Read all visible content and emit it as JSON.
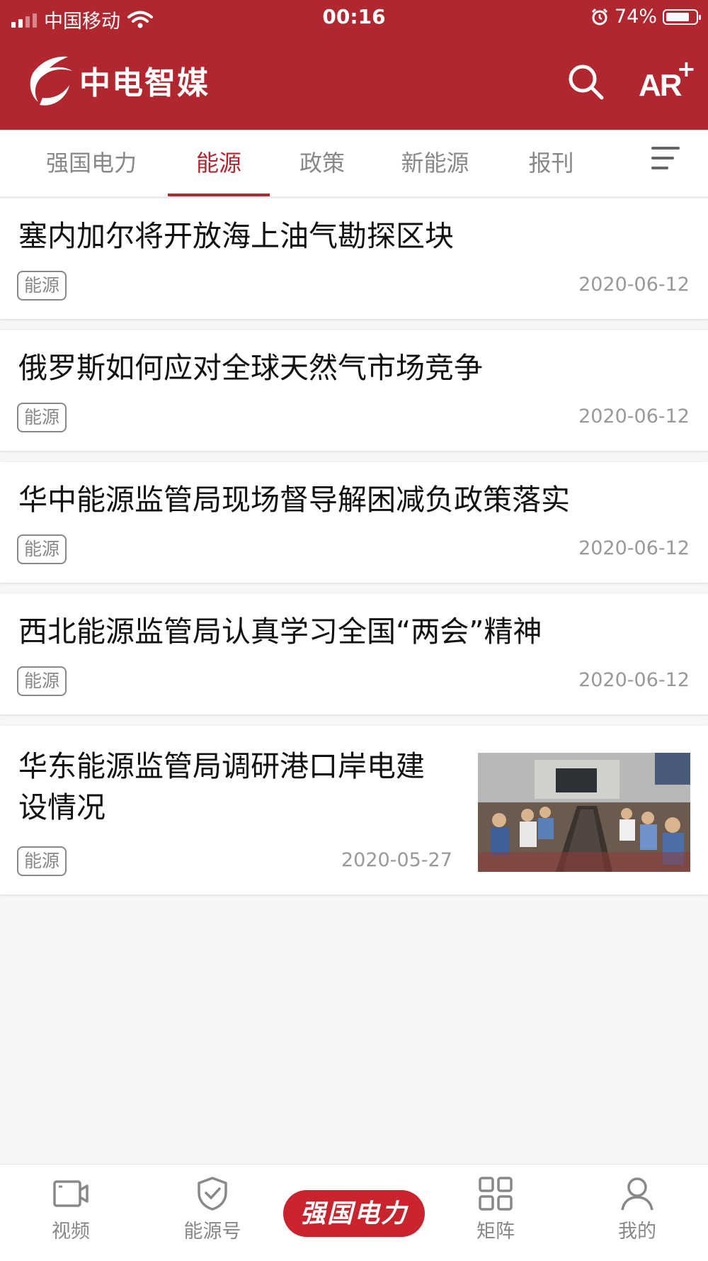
{
  "status_bar": {
    "carrier": "中国移动",
    "time": "00:16",
    "battery": "74%",
    "battery_level": 0.74
  },
  "header": {
    "app_name": "中电智媒",
    "ar_label": "AR",
    "ar_plus": "+",
    "brand_color": "#b0272f"
  },
  "tabs": [
    {
      "label": "强国电力",
      "active": false
    },
    {
      "label": "能源",
      "active": true
    },
    {
      "label": "政策",
      "active": false
    },
    {
      "label": "新能源",
      "active": false
    },
    {
      "label": "报刊",
      "active": false
    }
  ],
  "articles": [
    {
      "title": "塞内加尔将开放海上油气勘探区块",
      "tag": "能源",
      "date": "2020-06-12"
    },
    {
      "title": "俄罗斯如何应对全球天然气市场竞争",
      "tag": "能源",
      "date": "2020-06-12"
    },
    {
      "title": "华中能源监管局现场督导解困减负政策落实",
      "tag": "能源",
      "date": "2020-06-12"
    },
    {
      "title": "西北能源监管局认真学习全国“两会”精神",
      "tag": "能源",
      "date": "2020-06-12"
    },
    {
      "title_line1": "华东能源监管局调研港口岸电建",
      "title_line2": "设情况",
      "tag": "能源",
      "date": "2020-05-27",
      "image": "meeting-room-photo"
    }
  ],
  "bottom_nav": {
    "video": "视频",
    "energy_account": "能源号",
    "center": "强国电力",
    "matrix": "矩阵",
    "mine": "我的"
  }
}
